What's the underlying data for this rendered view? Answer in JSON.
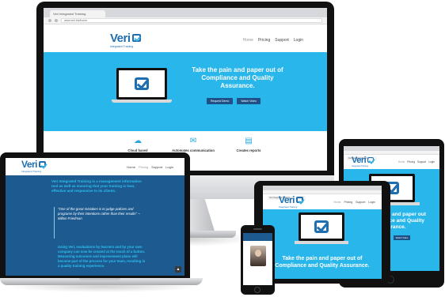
{
  "colors": {
    "brand_blue": "#1f6fb0",
    "hero_cyan": "#29b6ea",
    "dark_navy": "#1d5a8f",
    "button_navy": "#1f4f87",
    "accent_cyan": "#2cc0f0"
  },
  "brand": {
    "logo_word": "Veri",
    "logo_sub": "Integrated Training"
  },
  "nav": {
    "home": "Home",
    "pricing": "Pricing",
    "support": "Support",
    "login": "Login"
  },
  "desktop": {
    "tab_title": "Veri Integrated Training",
    "url": "www.veri.biz/home",
    "hero_title": "Take the pain and paper out of Compliance and Quality Assurance.",
    "button_primary": "Request Demo",
    "button_secondary": "Watch Video",
    "features": [
      {
        "icon": "cloud-icon",
        "label": "Cloud based"
      },
      {
        "icon": "chat-bubbles-icon",
        "label": "Automates communication"
      },
      {
        "icon": "document-icon",
        "label": "Creates reports"
      }
    ]
  },
  "laptop": {
    "intro": "Veri Integrated Training is a management information tool as well as ensuring that your training is lean, effective and responsive to its clients.",
    "quote": "\"One of the great mistakes is to judge policies and programs by their intentions rather than their results\" ~ Milton Friedman",
    "outro": "Using Veri, evaluations by learners and by your own company can now be created at the touch of a button. Measuring outcomes and improvement plans will become part of the process for your team, resulting in a quality training experience."
  },
  "ipad": {
    "hero_title": "Take the pain and paper out of Compliance and Quality Assurance."
  },
  "tablet": {
    "hero_title": "Take the pain and paper out of Compliance and Quality Assurance."
  }
}
